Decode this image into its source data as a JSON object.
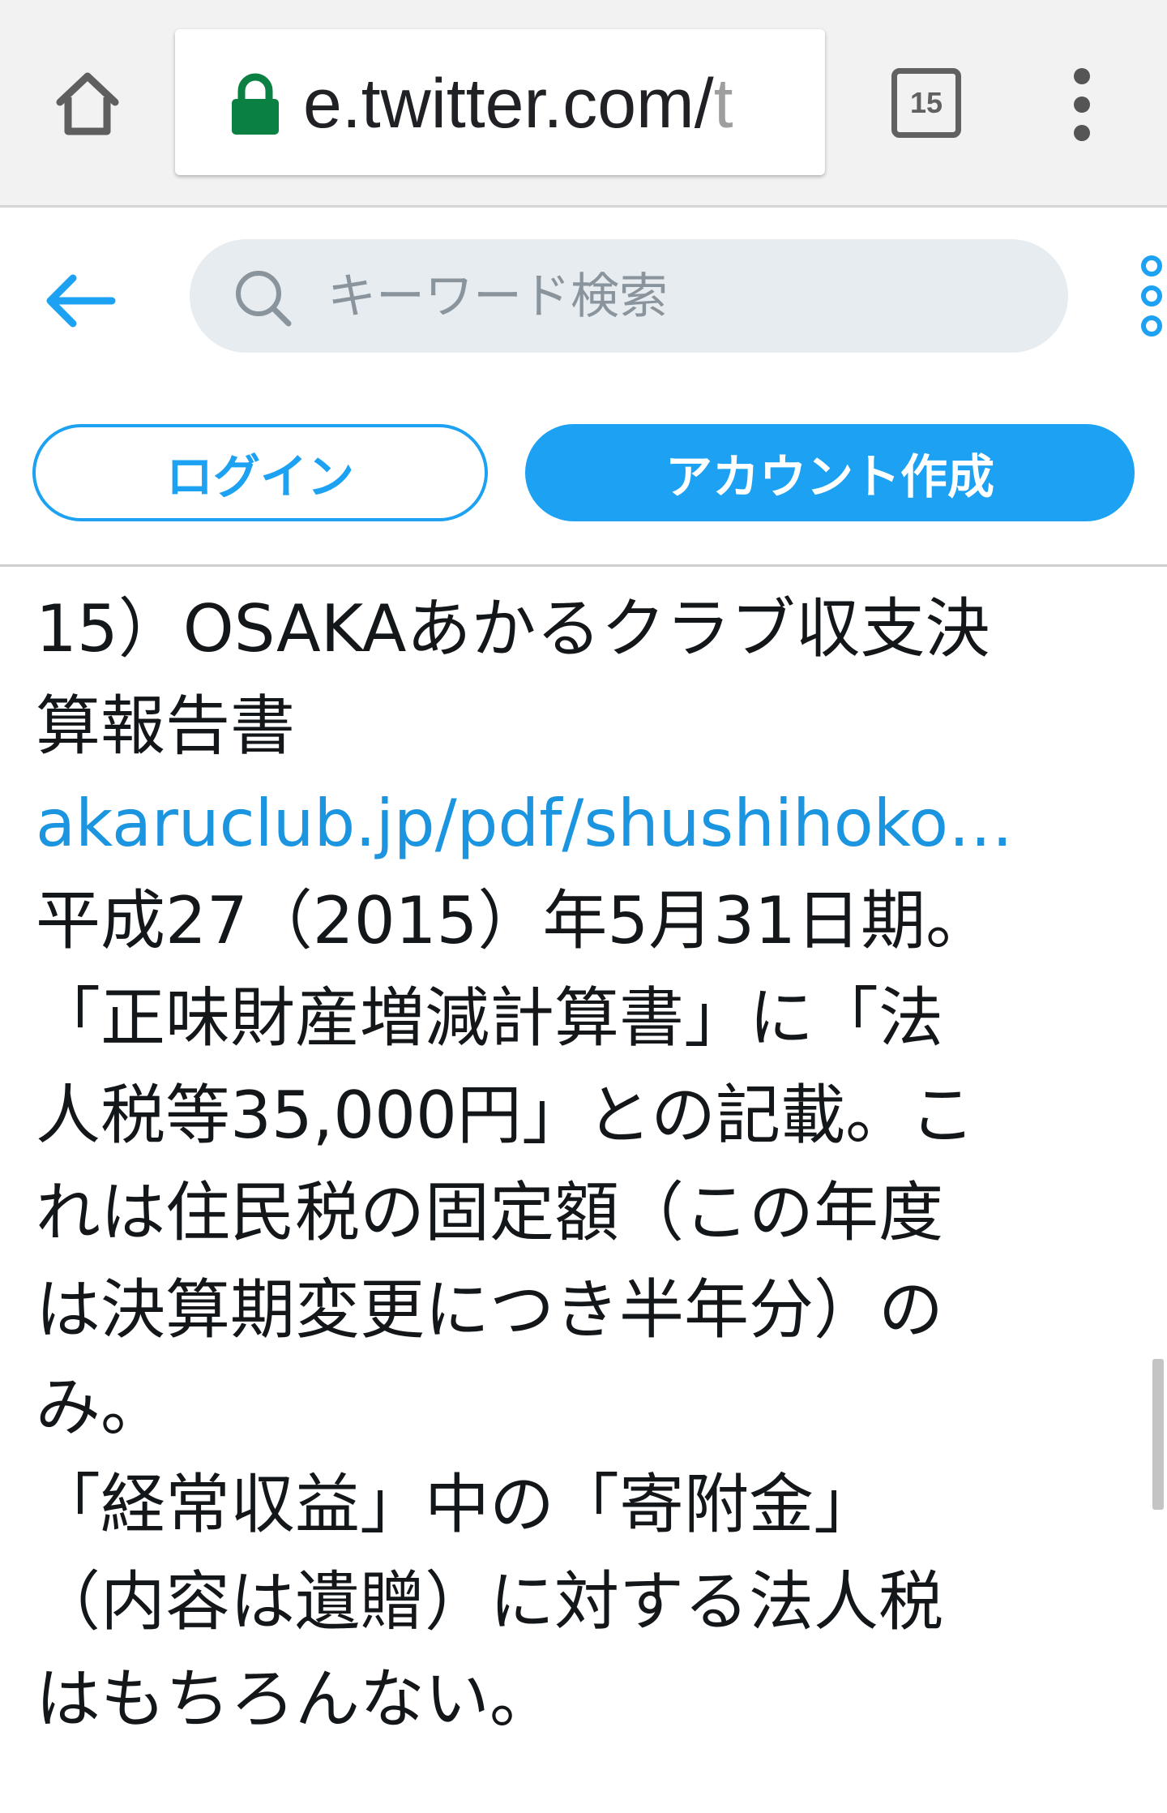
{
  "browser": {
    "url_main": "e.twitter.com/",
    "url_rest": "t",
    "tab_count": "15"
  },
  "header": {
    "search_placeholder": "キーワード検索",
    "login_label": "ログイン",
    "signup_label": "アカウント作成"
  },
  "tweet": {
    "lines": [
      "15）OSAKAあかるクラブ収支決",
      "算報告書",
      "akaruclub.jp/pdf/shushihoko…",
      "平成27（2015）年5月31日期。",
      "「正味財産増減計算書」に「法",
      "人税等35,000円」との記載。こ",
      "れは住民税の固定額（この年度",
      "は決算期変更につき半年分）の",
      "み。",
      "「経常収益」中の「寄附金」",
      "（内容は遺贈）に対する法人税",
      "はもちろんない。"
    ]
  },
  "colors": {
    "twitter_blue": "#1da1f2",
    "link_blue": "#1b95e0",
    "lock_green": "#0b8043",
    "search_bg": "#e6ecf0"
  },
  "icons": {
    "home": "home-icon",
    "lock": "lock-icon",
    "tabs": "tab-switcher-icon",
    "menu": "more-vert-icon",
    "back": "arrow-left-icon",
    "search": "search-icon",
    "more": "more-dots-icon"
  }
}
